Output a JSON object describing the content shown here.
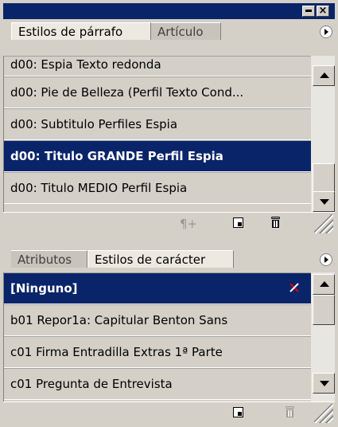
{
  "paragraph_panel": {
    "tabs": [
      {
        "label": "Estilos de párrafo"
      },
      {
        "label": "Artículo"
      }
    ],
    "items": [
      {
        "label": "d00: Espia Texto redonda"
      },
      {
        "label": "d00: Pie de Belleza (Perfil Texto Cond..."
      },
      {
        "label": "d00: Subtitulo Perfiles Espia"
      },
      {
        "label": "d00: Titulo GRANDE Perfil Espia"
      },
      {
        "label": "d00: Titulo MEDIO Perfil Espia"
      }
    ],
    "footer_icons": [
      "clear-overrides-icon",
      "new-style-icon",
      "delete-style-icon"
    ]
  },
  "character_panel": {
    "tabs": [
      {
        "label": "Atributos"
      },
      {
        "label": "Estilos de carácter"
      }
    ],
    "items": [
      {
        "label": "[Ninguno]"
      },
      {
        "label": "b01 Repor1a: Capitular Benton Sans"
      },
      {
        "label": "c01 Firma Entradilla Extras 1ª Parte"
      },
      {
        "label": "c01 Pregunta de Entrevista"
      }
    ],
    "footer_icons": [
      "new-style-icon",
      "delete-style-icon"
    ]
  },
  "colors": {
    "selection": "#0a246a",
    "panel_bg": "#d4d0c8"
  }
}
